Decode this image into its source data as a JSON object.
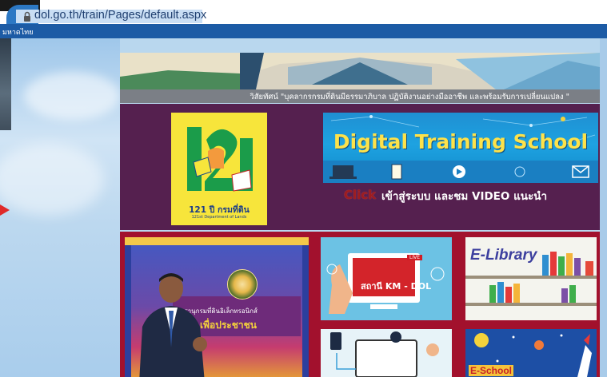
{
  "browser": {
    "url": "dol.go.th/train/Pages/default.aspx"
  },
  "site": {
    "title_fragment": "มหาดไทย"
  },
  "banner": {
    "vision": "วิสัยทัศน์ \"บุคลากรกรมที่ดินมีธรรมาภิบาล ปฏิบัติงานอย่างมืออาชีพ และพร้อมรับการเปลี่ยนแปลง \""
  },
  "promo": {
    "anniversary_caption": "121 ปี กรมที่ดิน",
    "anniversary_caption_en": "121st Department of Lands",
    "anniversary_number": "121",
    "digital_training_title": "Digital Training School",
    "click_word": "Click",
    "click_text": "เข้าสู่ระบบ และชม VIDEO แนะนำ"
  },
  "tiles": {
    "main": {
      "line1": "สารานุกรมที่ดินอิเล็กทรอนิกส์",
      "line2": "เพื่อประชาชน"
    },
    "km": {
      "label": "สถานี KM - DOL",
      "live": "LIVE"
    },
    "elibrary": {
      "title": "E-Library"
    },
    "eschool": {
      "label": "E-School"
    }
  },
  "colors": {
    "purple": "#55204f",
    "maroon": "#a2112d",
    "dts_blue": "#1ea2e1",
    "title_yellow": "#fde24a"
  }
}
